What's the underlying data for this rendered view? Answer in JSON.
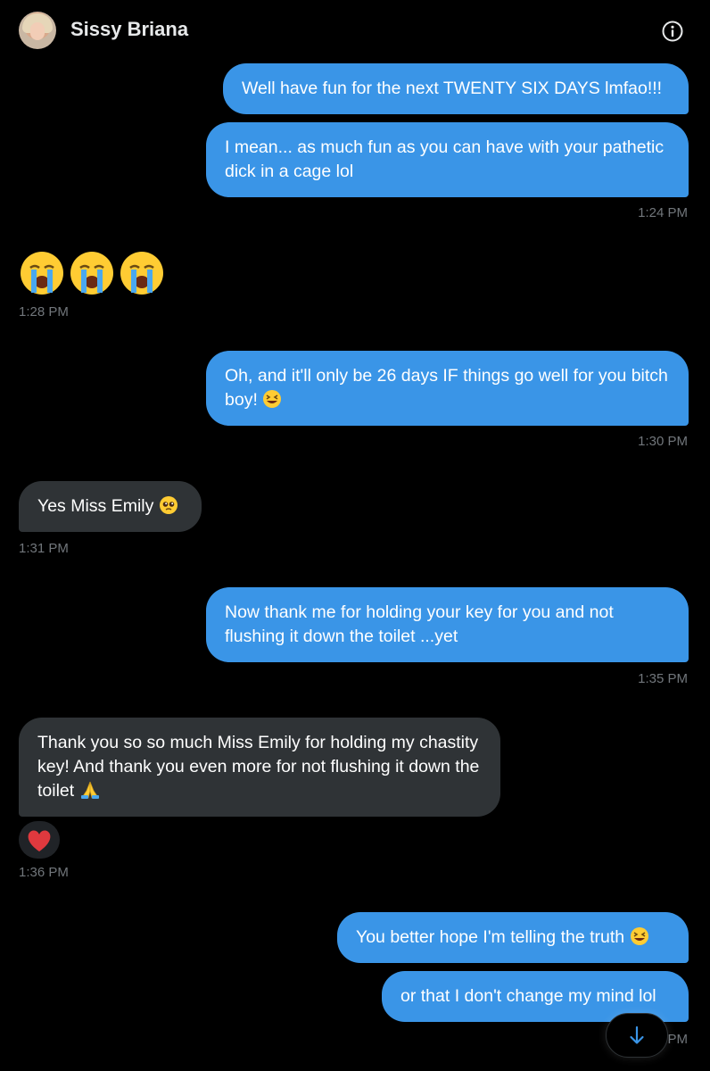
{
  "header": {
    "name": "Sissy Briana",
    "info_icon": "info-circle-icon"
  },
  "messages": [
    {
      "dir": "out",
      "text": "Well have fun for the next TWENTY SIX DAYS lmfao!!!"
    },
    {
      "dir": "out",
      "text": "I mean... as much fun as you can have with your pathetic dick in a cage lol"
    },
    {
      "dir": "out",
      "time": "1:24 PM"
    },
    {
      "dir": "in",
      "emoji": "crying-face-x3",
      "time": "1:28 PM"
    },
    {
      "dir": "out",
      "text": "Oh, and it'll only be 26 days IF things go well for you bitch boy!",
      "emoji": "grinning-squinting-face",
      "time": "1:30 PM"
    },
    {
      "dir": "in",
      "text": "Yes Miss Emily",
      "emoji": "pleading-face",
      "time": "1:31 PM"
    },
    {
      "dir": "out",
      "text": "Now thank me for holding your key for you and not flushing it down the toilet ...yet",
      "time": "1:35 PM"
    },
    {
      "dir": "in",
      "text": "Thank you so so much Miss Emily for holding my chastity key! And thank you even more for not flushing it down the toilet",
      "emoji": "folded-hands",
      "reaction": "red-heart",
      "time": "1:36 PM"
    },
    {
      "dir": "out",
      "text": "You better hope I'm telling the truth",
      "emoji": "grinning-squinting-face"
    },
    {
      "dir": "out",
      "text": "or that I don't change my mind lol",
      "time_partial": "PM"
    }
  ],
  "scroll_button_icon": "arrow-down-icon",
  "colors": {
    "outgoing_bubble": "#3a95e7",
    "incoming_bubble": "#2f3336",
    "timestamp": "#71767b",
    "background": "#000000"
  }
}
